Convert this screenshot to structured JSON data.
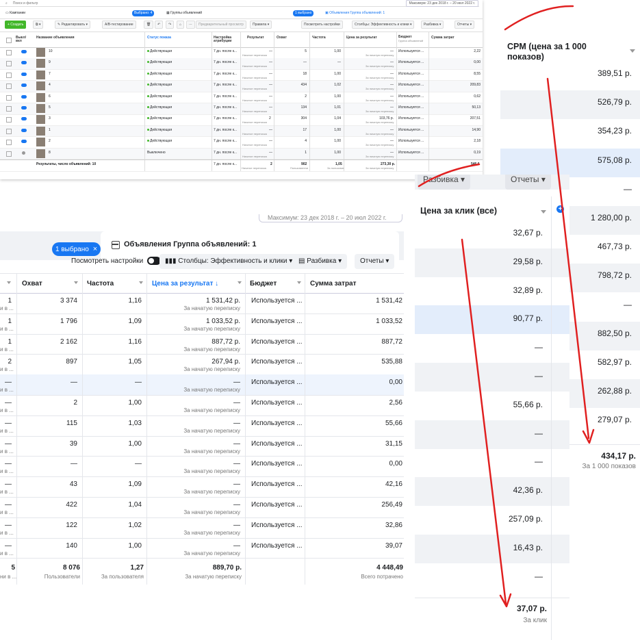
{
  "s1": {
    "search_placeholder": "Поиск и фильтр",
    "date_range": "Максимум: 23 дек 2018 г. – 20 июл 2022 г.",
    "tabs": {
      "campaigns": "Кампании",
      "campaigns_selected": "Выбрано: 4",
      "adsets": "Группы объявлений",
      "adsets_selected": "1 выбрано",
      "ads": "Объявления Группа объявлений: 1"
    },
    "toolbar": {
      "create": "+ Создать",
      "edit": "Редактировать",
      "ab_test": "A/B-тестирование",
      "preview": "Предварительный просмотр",
      "rules": "Правила",
      "view_settings": "Посмотреть настройки",
      "columns": "Столбцы: Эффективность и клики",
      "breakdown": "Разбивка",
      "reports": "Отчеты"
    },
    "headers": {
      "onoff": "Выкл/вкл",
      "name": "Название объявления",
      "status": "Статус показа",
      "attribution": "Настройка атрибуции",
      "results": "Результат",
      "reach": "Охват",
      "frequency": "Частота",
      "cost_per_result": "Цена за результат",
      "budget": "Бюджет",
      "budget_sub": "Группа объявлений",
      "amount_spent": "Сумма затрат"
    },
    "rows": [
      {
        "name": "10",
        "status": "Действующая",
        "attr": "7 дн. после к...",
        "result": "—",
        "result_sub": "Начатое переписка",
        "reach": "5",
        "freq": "1,00",
        "cpr": "—",
        "cpr_sub": "За начатую переписку",
        "budget": "Используется ...",
        "spent": "2,22",
        "active": true
      },
      {
        "name": "9",
        "status": "Действующая",
        "attr": "7 дн. после к...",
        "result": "—",
        "result_sub": "Начатое переписка",
        "reach": "—",
        "freq": "—",
        "cpr": "—",
        "cpr_sub": "За начатую переписку",
        "budget": "Используется ...",
        "spent": "0,00",
        "active": true
      },
      {
        "name": "7",
        "status": "Действующая",
        "attr": "7 дн. после к...",
        "result": "—",
        "result_sub": "Начатое переписка",
        "reach": "18",
        "freq": "1,00",
        "cpr": "—",
        "cpr_sub": "За начатую переписку",
        "budget": "Используется ...",
        "spent": "8,55",
        "active": true
      },
      {
        "name": "4",
        "status": "Действующая",
        "attr": "7 дн. после к...",
        "result": "—",
        "result_sub": "Начатое переписка",
        "reach": "434",
        "freq": "1,02",
        "cpr": "—",
        "cpr_sub": "За начатую переписку",
        "budget": "Используется ...",
        "spent": "209,83",
        "active": true
      },
      {
        "name": "6",
        "status": "Действующая",
        "attr": "7 дн. после к...",
        "result": "—",
        "result_sub": "Начатое переписка",
        "reach": "2",
        "freq": "1,00",
        "cpr": "—",
        "cpr_sub": "За начатую переписку",
        "budget": "Используется ...",
        "spent": "0,62",
        "active": true
      },
      {
        "name": "5",
        "status": "Действующая",
        "attr": "7 дн. после к...",
        "result": "—",
        "result_sub": "Начатое переписка",
        "reach": "134",
        "freq": "1,01",
        "cpr": "—",
        "cpr_sub": "За начатую переписку",
        "budget": "Используется ...",
        "spent": "50,13",
        "active": true
      },
      {
        "name": "3",
        "status": "Действующая",
        "attr": "7 дн. после к...",
        "result": "2",
        "result_sub": "Начатое переписка",
        "reach": "304",
        "freq": "1,04",
        "cpr": "103,76 р.",
        "cpr_sub": "За начатую переписку",
        "budget": "Используется ...",
        "spent": "207,51",
        "active": true
      },
      {
        "name": "1",
        "status": "Действующая",
        "attr": "7 дн. после к...",
        "result": "—",
        "result_sub": "Начатое переписка",
        "reach": "17",
        "freq": "1,00",
        "cpr": "—",
        "cpr_sub": "За начатую переписку",
        "budget": "Используется ...",
        "spent": "14,90",
        "active": true
      },
      {
        "name": "2",
        "status": "Действующая",
        "attr": "7 дн. после к...",
        "result": "—",
        "result_sub": "Начатое переписка",
        "reach": "4",
        "freq": "1,00",
        "cpr": "—",
        "cpr_sub": "За начатую переписку",
        "budget": "Используется ...",
        "spent": "2,18",
        "active": true
      },
      {
        "name": "8",
        "status": "Выключено",
        "attr": "7 дн. после к...",
        "result": "—",
        "result_sub": "Начатое переписка",
        "reach": "1",
        "freq": "1,00",
        "cpr": "—",
        "cpr_sub": "За начатую переписку",
        "budget": "Используется ...",
        "spent": "0,19",
        "active": false
      }
    ],
    "total": {
      "label": "Результаты, число объявлений: 10",
      "attr": "7 дн. после к...",
      "attr_sub": "Начатое переписка",
      "result": "2",
      "result_sub": "Пользователи",
      "reach": "902",
      "freq": "1,05",
      "freq_sub": "За пользоват.",
      "cpr": "273,30 р.",
      "cpr_sub": "За начатую переписку",
      "spent": "546,6"
    }
  },
  "s2": {
    "date_range": "Максимум: 23 дек 2018 г. – 20 июл 2022 г.",
    "selected_pill": "1 выбрано",
    "ads_tab": "Объявления Группа объявлений: 1",
    "view_settings": "Посмотреть настройки",
    "columns": "Столбцы: Эффективность и клики",
    "breakdown": "Разбивка",
    "reports": "Отчеты",
    "headers": {
      "reach": "Охват",
      "frequency": "Частота",
      "cost_per_result": "Цена за результат ↓",
      "budget": "Бюджет",
      "amount_spent": "Сумма затрат"
    },
    "rows": [
      {
        "left": "1",
        "lsub": "и в ...",
        "reach": "3 374",
        "freq": "1,16",
        "cpr": "1 531,42 р.",
        "cpr_sub": "За начатую переписку",
        "budget": "Используется ...",
        "spent": "1 531,42"
      },
      {
        "left": "1",
        "lsub": "и в ...",
        "reach": "1 796",
        "freq": "1,09",
        "cpr": "1 033,52 р.",
        "cpr_sub": "За начатую переписку",
        "budget": "Используется ...",
        "spent": "1 033,52"
      },
      {
        "left": "1",
        "lsub": "и в ...",
        "reach": "2 162",
        "freq": "1,16",
        "cpr": "887,72 р.",
        "cpr_sub": "За начатую переписку",
        "budget": "Используется ...",
        "spent": "887,72"
      },
      {
        "left": "2",
        "lsub": "и в ...",
        "reach": "897",
        "freq": "1,05",
        "cpr": "267,94 р.",
        "cpr_sub": "За начатую переписку",
        "budget": "Используется ...",
        "spent": "535,88"
      },
      {
        "left": "—",
        "lsub": "и в ...",
        "reach": "—",
        "freq": "—",
        "cpr": "—",
        "cpr_sub": "За начатую переписку",
        "budget": "Используется ...",
        "spent": "0,00"
      },
      {
        "left": "—",
        "lsub": "и в ...",
        "reach": "2",
        "freq": "1,00",
        "cpr": "—",
        "cpr_sub": "За начатую переписку",
        "budget": "Используется ...",
        "spent": "2,56"
      },
      {
        "left": "—",
        "lsub": "и в ...",
        "reach": "115",
        "freq": "1,03",
        "cpr": "—",
        "cpr_sub": "За начатую переписку",
        "budget": "Используется ...",
        "spent": "55,66"
      },
      {
        "left": "—",
        "lsub": "и в ...",
        "reach": "39",
        "freq": "1,00",
        "cpr": "—",
        "cpr_sub": "За начатую переписку",
        "budget": "Используется ...",
        "spent": "31,15"
      },
      {
        "left": "—",
        "lsub": "и в ...",
        "reach": "—",
        "freq": "—",
        "cpr": "—",
        "cpr_sub": "За начатую переписку",
        "budget": "Используется ...",
        "spent": "0,00"
      },
      {
        "left": "—",
        "lsub": "и в ...",
        "reach": "43",
        "freq": "1,09",
        "cpr": "—",
        "cpr_sub": "За начатую переписку",
        "budget": "Используется ...",
        "spent": "42,16"
      },
      {
        "left": "—",
        "lsub": "и в ...",
        "reach": "422",
        "freq": "1,04",
        "cpr": "—",
        "cpr_sub": "За начатую переписку",
        "budget": "Используется ...",
        "spent": "256,49"
      },
      {
        "left": "—",
        "lsub": "и в ...",
        "reach": "122",
        "freq": "1,02",
        "cpr": "—",
        "cpr_sub": "За начатую переписку",
        "budget": "Используется ...",
        "spent": "32,86"
      },
      {
        "left": "—",
        "lsub": "и в ...",
        "reach": "140",
        "freq": "1,00",
        "cpr": "—",
        "cpr_sub": "За начатую переписку",
        "budget": "Используется ...",
        "spent": "39,07"
      }
    ],
    "total": {
      "left": "5",
      "lsub": "ни в ...",
      "reach": "8 076",
      "reach_sub": "Пользователи",
      "freq": "1,27",
      "freq_sub": "За пользователя",
      "cpr": "889,70 р.",
      "cpr_sub": "За начатую переписку",
      "spent": "4 448,49",
      "spent_sub": "Всего потрачено"
    }
  },
  "s3": {
    "header": "CPM (цена за 1 000 показов)",
    "values": [
      "389,51 р.",
      "526,79 р.",
      "354,23 р.",
      "575,08 р.",
      "—",
      "1 280,00 р.",
      "467,73 р.",
      "798,72 р.",
      "—",
      "882,50 р.",
      "582,97 р.",
      "262,88 р.",
      "279,07 р."
    ],
    "total": "434,17 р.",
    "total_sub": "За 1 000 показов"
  },
  "s4": {
    "breakdown": "Разбивка",
    "reports": "Отчеты",
    "header": "Цена за клик (все)",
    "values": [
      "32,67 р.",
      "29,58 р.",
      "32,89 р.",
      "90,77 р.",
      "—",
      "—",
      "55,66 р.",
      "—",
      "—",
      "42,36 р.",
      "257,09 р.",
      "16,43 р.",
      "—"
    ],
    "total": "37,07 р.",
    "total_sub": "За клик"
  },
  "colors": {
    "accent": "#1877f2",
    "arrow": "#e02020",
    "active": "#42b72a"
  }
}
